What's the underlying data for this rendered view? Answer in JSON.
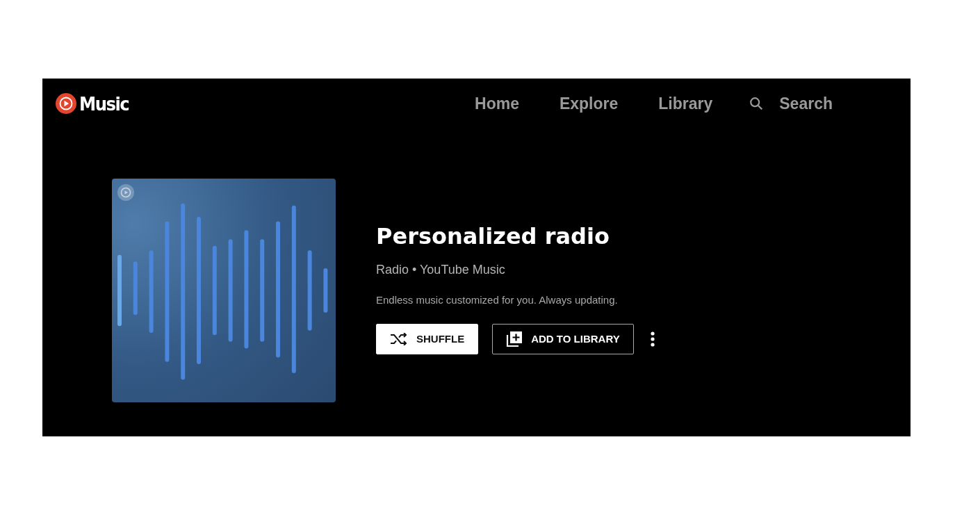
{
  "logo": {
    "text": "Music"
  },
  "nav": [
    {
      "label": "Home"
    },
    {
      "label": "Explore"
    },
    {
      "label": "Library"
    }
  ],
  "search": {
    "label": "Search"
  },
  "playlist": {
    "title": "Personalized radio",
    "subtitle": "Radio • YouTube Music",
    "description": "Endless music customized for you. Always updating."
  },
  "buttons": [
    {
      "kind": "primary",
      "label": "SHUFFLE"
    },
    {
      "kind": "outline",
      "label": "ADD TO LIBRARY"
    }
  ]
}
